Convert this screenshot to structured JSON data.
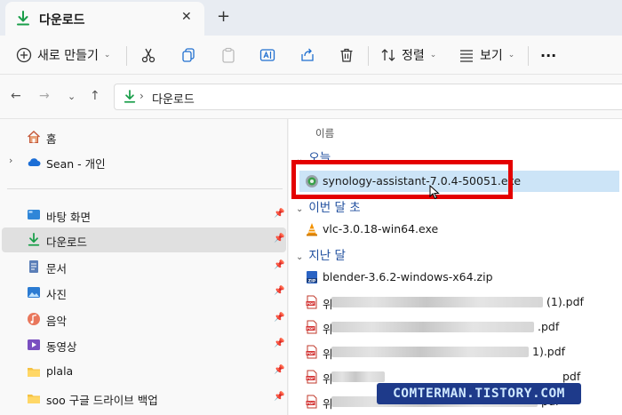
{
  "tab": {
    "title": "다운로드",
    "close": "✕",
    "new": "+"
  },
  "toolbar": {
    "new_label": "새로 만들기",
    "sort_label": "정렬",
    "view_label": "보기",
    "more_label": "···",
    "caret": "⌄"
  },
  "nav": {
    "back": "←",
    "forward": "→",
    "recent": "⌄",
    "up": "↑"
  },
  "address": {
    "chevron": "›",
    "path": "다운로드"
  },
  "sidebar": {
    "home": "홈",
    "onedrive": "Sean - 개인",
    "expander": "›",
    "pin": "📌",
    "items": [
      {
        "label": "바탕 화면",
        "icon": "desktop-icon"
      },
      {
        "label": "다운로드",
        "icon": "download-icon"
      },
      {
        "label": "문서",
        "icon": "document-icon"
      },
      {
        "label": "사진",
        "icon": "picture-icon"
      },
      {
        "label": "음악",
        "icon": "music-icon"
      },
      {
        "label": "동영상",
        "icon": "video-icon"
      },
      {
        "label": "plala",
        "icon": "folder-icon"
      },
      {
        "label": "soo 구글 드라이브 백업",
        "icon": "folder-icon"
      }
    ]
  },
  "content": {
    "column_name": "이름",
    "groups": {
      "today": "오늘",
      "this_month": "이번 달 초",
      "last_month": "지난 달"
    },
    "files": {
      "synology": "synology-assistant-7.0.4-50051.exe",
      "vlc": "vlc-3.0.18-win64.exe",
      "blender": "blender-3.6.2-windows-x64.zip",
      "pdf1_prefix": "위",
      "pdf1_suffix": "(1).pdf",
      "pdf2_prefix": "위",
      "pdf2_suffix": ".pdf",
      "pdf3_prefix": "위",
      "pdf3_suffix": "1).pdf",
      "pdf4_prefix": "위",
      "pdf4_suffix": "pdf",
      "pdf5_prefix": "위",
      "pdf5_suffix": "pdf"
    }
  },
  "watermark": "COMTERMAN.TISTORY.COM",
  "colors": {
    "accent": "#1f4e9e",
    "highlight": "#e40000",
    "selected": "#cce4f7",
    "download_green": "#1a9e4a"
  }
}
